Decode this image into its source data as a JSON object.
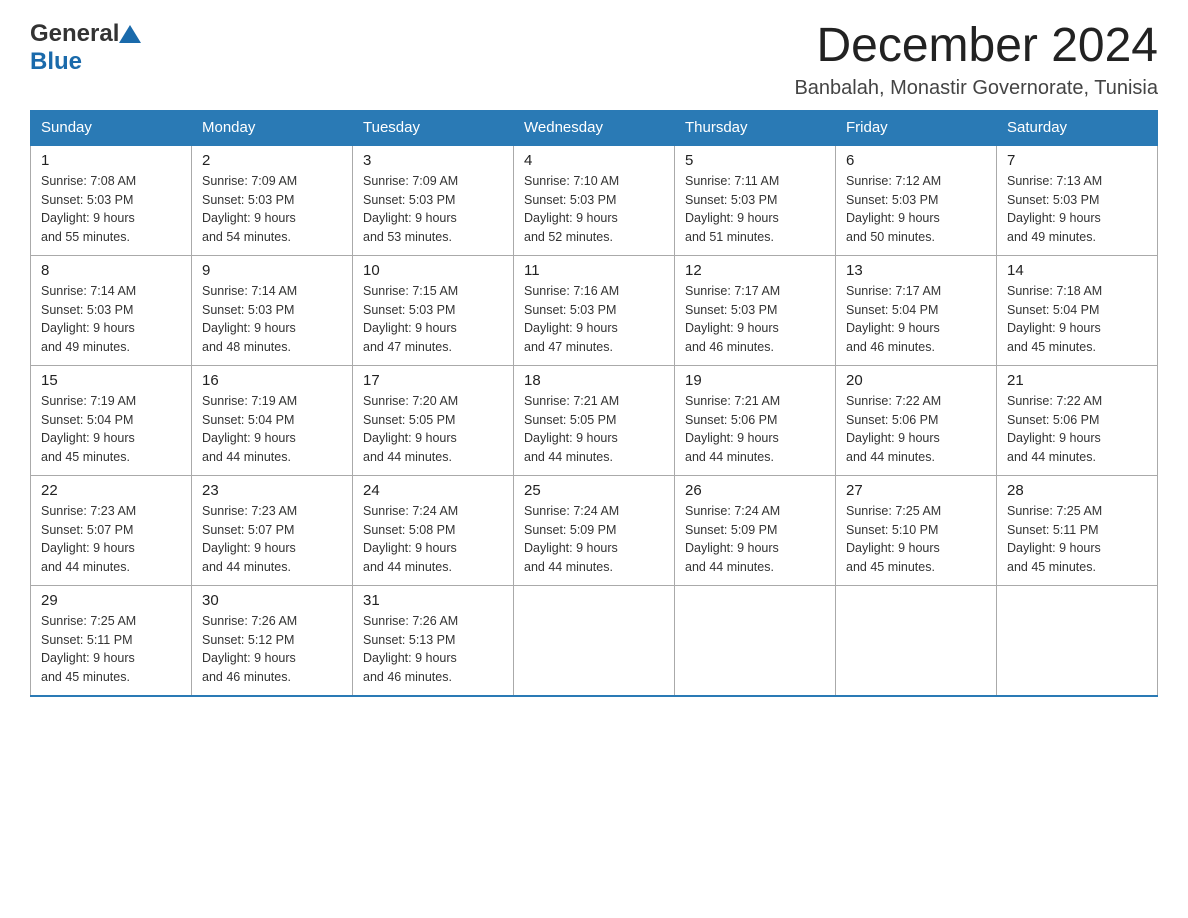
{
  "header": {
    "logo_general": "General",
    "logo_blue": "Blue",
    "month_title": "December 2024",
    "location": "Banbalah, Monastir Governorate, Tunisia"
  },
  "days_of_week": [
    "Sunday",
    "Monday",
    "Tuesday",
    "Wednesday",
    "Thursday",
    "Friday",
    "Saturday"
  ],
  "weeks": [
    [
      {
        "day": "1",
        "sunrise": "7:08 AM",
        "sunset": "5:03 PM",
        "daylight": "9 hours and 55 minutes."
      },
      {
        "day": "2",
        "sunrise": "7:09 AM",
        "sunset": "5:03 PM",
        "daylight": "9 hours and 54 minutes."
      },
      {
        "day": "3",
        "sunrise": "7:09 AM",
        "sunset": "5:03 PM",
        "daylight": "9 hours and 53 minutes."
      },
      {
        "day": "4",
        "sunrise": "7:10 AM",
        "sunset": "5:03 PM",
        "daylight": "9 hours and 52 minutes."
      },
      {
        "day": "5",
        "sunrise": "7:11 AM",
        "sunset": "5:03 PM",
        "daylight": "9 hours and 51 minutes."
      },
      {
        "day": "6",
        "sunrise": "7:12 AM",
        "sunset": "5:03 PM",
        "daylight": "9 hours and 50 minutes."
      },
      {
        "day": "7",
        "sunrise": "7:13 AM",
        "sunset": "5:03 PM",
        "daylight": "9 hours and 49 minutes."
      }
    ],
    [
      {
        "day": "8",
        "sunrise": "7:14 AM",
        "sunset": "5:03 PM",
        "daylight": "9 hours and 49 minutes."
      },
      {
        "day": "9",
        "sunrise": "7:14 AM",
        "sunset": "5:03 PM",
        "daylight": "9 hours and 48 minutes."
      },
      {
        "day": "10",
        "sunrise": "7:15 AM",
        "sunset": "5:03 PM",
        "daylight": "9 hours and 47 minutes."
      },
      {
        "day": "11",
        "sunrise": "7:16 AM",
        "sunset": "5:03 PM",
        "daylight": "9 hours and 47 minutes."
      },
      {
        "day": "12",
        "sunrise": "7:17 AM",
        "sunset": "5:03 PM",
        "daylight": "9 hours and 46 minutes."
      },
      {
        "day": "13",
        "sunrise": "7:17 AM",
        "sunset": "5:04 PM",
        "daylight": "9 hours and 46 minutes."
      },
      {
        "day": "14",
        "sunrise": "7:18 AM",
        "sunset": "5:04 PM",
        "daylight": "9 hours and 45 minutes."
      }
    ],
    [
      {
        "day": "15",
        "sunrise": "7:19 AM",
        "sunset": "5:04 PM",
        "daylight": "9 hours and 45 minutes."
      },
      {
        "day": "16",
        "sunrise": "7:19 AM",
        "sunset": "5:04 PM",
        "daylight": "9 hours and 44 minutes."
      },
      {
        "day": "17",
        "sunrise": "7:20 AM",
        "sunset": "5:05 PM",
        "daylight": "9 hours and 44 minutes."
      },
      {
        "day": "18",
        "sunrise": "7:21 AM",
        "sunset": "5:05 PM",
        "daylight": "9 hours and 44 minutes."
      },
      {
        "day": "19",
        "sunrise": "7:21 AM",
        "sunset": "5:06 PM",
        "daylight": "9 hours and 44 minutes."
      },
      {
        "day": "20",
        "sunrise": "7:22 AM",
        "sunset": "5:06 PM",
        "daylight": "9 hours and 44 minutes."
      },
      {
        "day": "21",
        "sunrise": "7:22 AM",
        "sunset": "5:06 PM",
        "daylight": "9 hours and 44 minutes."
      }
    ],
    [
      {
        "day": "22",
        "sunrise": "7:23 AM",
        "sunset": "5:07 PM",
        "daylight": "9 hours and 44 minutes."
      },
      {
        "day": "23",
        "sunrise": "7:23 AM",
        "sunset": "5:07 PM",
        "daylight": "9 hours and 44 minutes."
      },
      {
        "day": "24",
        "sunrise": "7:24 AM",
        "sunset": "5:08 PM",
        "daylight": "9 hours and 44 minutes."
      },
      {
        "day": "25",
        "sunrise": "7:24 AM",
        "sunset": "5:09 PM",
        "daylight": "9 hours and 44 minutes."
      },
      {
        "day": "26",
        "sunrise": "7:24 AM",
        "sunset": "5:09 PM",
        "daylight": "9 hours and 44 minutes."
      },
      {
        "day": "27",
        "sunrise": "7:25 AM",
        "sunset": "5:10 PM",
        "daylight": "9 hours and 45 minutes."
      },
      {
        "day": "28",
        "sunrise": "7:25 AM",
        "sunset": "5:11 PM",
        "daylight": "9 hours and 45 minutes."
      }
    ],
    [
      {
        "day": "29",
        "sunrise": "7:25 AM",
        "sunset": "5:11 PM",
        "daylight": "9 hours and 45 minutes."
      },
      {
        "day": "30",
        "sunrise": "7:26 AM",
        "sunset": "5:12 PM",
        "daylight": "9 hours and 46 minutes."
      },
      {
        "day": "31",
        "sunrise": "7:26 AM",
        "sunset": "5:13 PM",
        "daylight": "9 hours and 46 minutes."
      },
      null,
      null,
      null,
      null
    ]
  ],
  "labels": {
    "sunrise": "Sunrise:",
    "sunset": "Sunset:",
    "daylight": "Daylight:"
  }
}
